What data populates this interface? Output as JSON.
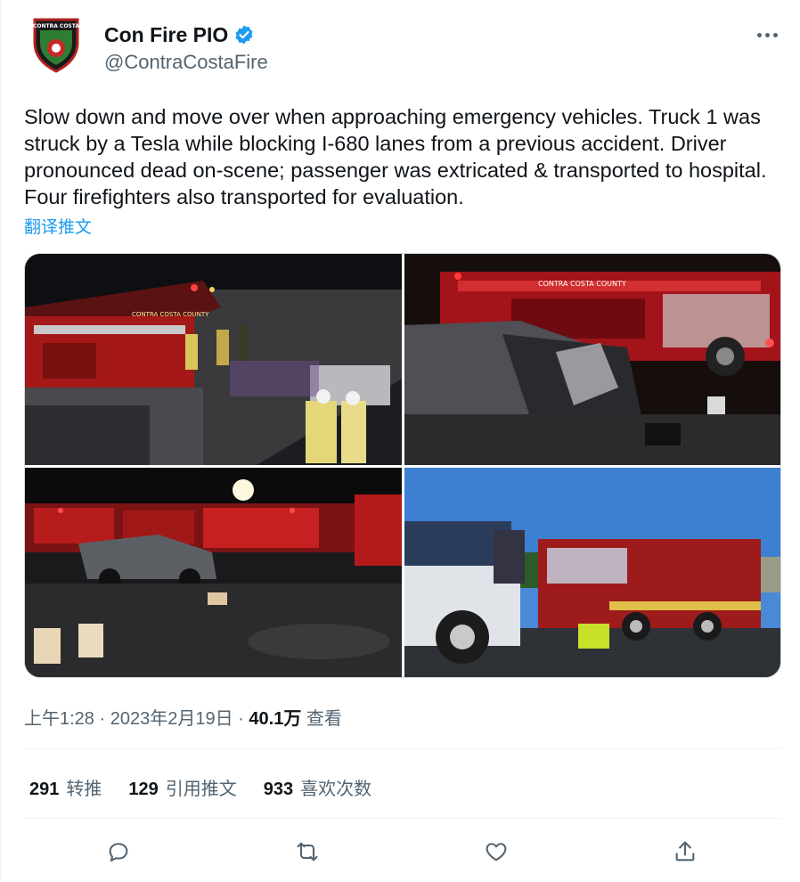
{
  "author": {
    "display_name": "Con Fire PIO",
    "handle": "@ContraCostaFire",
    "logo_text": "CONTRA COSTA"
  },
  "icons": {
    "verified": "verified-badge-icon",
    "more": "more-icon",
    "reply": "reply-icon",
    "retweet": "retweet-icon",
    "like": "like-icon",
    "share": "share-icon"
  },
  "tweet": {
    "text": "Slow down and move over when approaching emergency vehicles. Truck 1 was struck by a Tesla while blocking I-680 lanes from a previous accident. Driver pronounced dead on-scene; passenger was extricated & transported to hospital. Four firefighters also transported for evaluation.",
    "translate_label": "翻译推文"
  },
  "photos": {
    "truck_label_1": "CONTRA COSTA COUNTY",
    "truck_label_2": "CONTRA COSTA COUNTY"
  },
  "meta": {
    "time": "上午1:28",
    "sep1": "·",
    "date": "2023年2月19日",
    "sep2": "·",
    "views_count": "40.1万",
    "views_label": "查看"
  },
  "stats": {
    "retweets_count": "291",
    "retweets_label": "转推",
    "quotes_count": "129",
    "quotes_label": "引用推文",
    "likes_count": "933",
    "likes_label": "喜欢次数"
  },
  "colors": {
    "accent": "#1d9bf0",
    "secondary_text": "#536471",
    "primary_text": "#0f1419"
  }
}
